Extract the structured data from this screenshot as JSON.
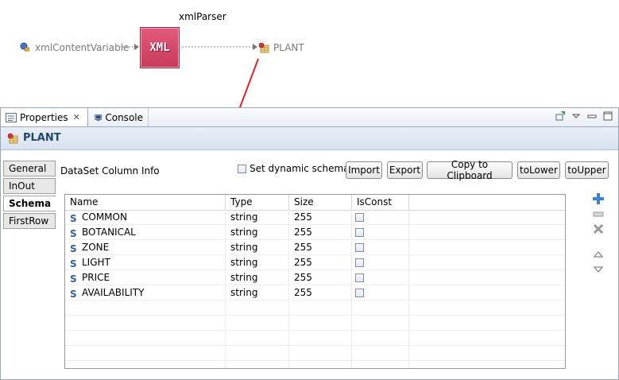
{
  "diagram": {
    "component_title": "xmlParser",
    "component_label": "XML",
    "input_variable": "xmlContentVariable",
    "output_node": "PLANT",
    "accent_color": "#d94a6c",
    "arrow_color": "#e52222"
  },
  "tabs": [
    {
      "label": "Properties",
      "icon": "properties-icon",
      "active": true
    },
    {
      "label": "Console",
      "icon": "console-icon",
      "active": false
    }
  ],
  "header": {
    "title": "PLANT",
    "icon": "table-node-icon"
  },
  "sidebar": {
    "items": [
      {
        "label": "General"
      },
      {
        "label": "InOut"
      },
      {
        "label": "Schema"
      },
      {
        "label": "FirstRow"
      }
    ],
    "selected": "Schema"
  },
  "schema": {
    "section_label": "DataSet Column Info",
    "dynamic_schema_label": "Set dynamic schema",
    "dynamic_schema_checked": false,
    "buttons": {
      "import": "Import",
      "export": "Export",
      "copy": "Copy to Clipboard",
      "tolower": "toLower",
      "toupper": "toUpper"
    },
    "columns": [
      "Name",
      "Type",
      "Size",
      "IsConst"
    ],
    "rows": [
      {
        "name": "COMMON",
        "type": "string",
        "size": "255",
        "isconst": false
      },
      {
        "name": "BOTANICAL",
        "type": "string",
        "size": "255",
        "isconst": false
      },
      {
        "name": "ZONE",
        "type": "string",
        "size": "255",
        "isconst": false
      },
      {
        "name": "LIGHT",
        "type": "string",
        "size": "255",
        "isconst": false
      },
      {
        "name": "PRICE",
        "type": "string",
        "size": "255",
        "isconst": false
      },
      {
        "name": "AVAILABILITY",
        "type": "string",
        "size": "255",
        "isconst": false
      }
    ]
  }
}
